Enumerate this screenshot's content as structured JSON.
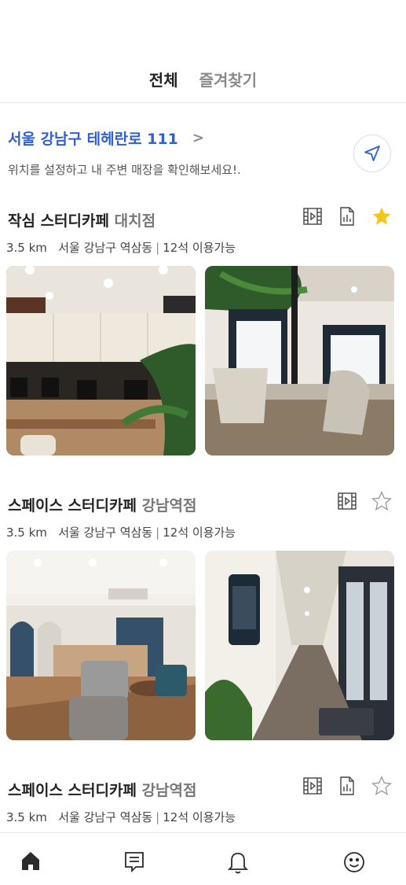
{
  "tabs": {
    "all_label": "전체",
    "favorites_label": "즐겨찾기"
  },
  "location": {
    "address": "서울 강남구 테헤란로 111",
    "chevron": ">",
    "subtitle": "위치를 설정하고 내 주변 매장을 확인해보세요!."
  },
  "stores": [
    {
      "name": "작심 스터디카페",
      "branch": "대치점",
      "distance": "3.5 km",
      "area": "서울 강남구 역삼동",
      "seats": "12석 이용가능",
      "favorite": true,
      "icons": [
        "film-icon",
        "document-chart-icon",
        "star-icon"
      ]
    },
    {
      "name": "스페이스 스터디카페",
      "branch": "강남역점",
      "distance": "3.5 km",
      "area": "서울 강남구 역삼동",
      "seats": "12석 이용가능",
      "favorite": false,
      "icons": [
        "film-icon",
        "star-outline-icon"
      ]
    },
    {
      "name": "스페이스 스터디카페",
      "branch": "강남역점",
      "distance": "3.5 km",
      "area": "서울 강남구 역삼동",
      "seats": "12석 이용가능",
      "favorite": false,
      "icons": [
        "film-icon",
        "document-chart-icon",
        "star-outline-icon"
      ]
    }
  ],
  "bottom_nav": [
    "home-icon",
    "list-icon",
    "bell-icon",
    "smile-icon"
  ],
  "colors": {
    "accent": "#2e5fd6",
    "star": "#f5c518",
    "text": "#222222",
    "muted": "#8a8a8a"
  }
}
